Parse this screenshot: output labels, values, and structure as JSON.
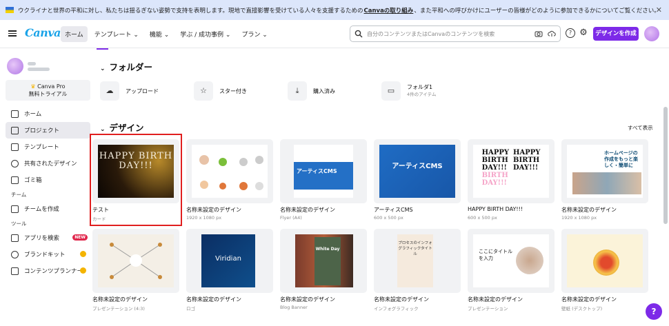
{
  "banner": {
    "text_before": "ウクライナと世界の平和に対し、私たちは揺るぎない姿勢で支持を表明します。現地で直接影響を受けている人々を支援するための",
    "link": "Canvaの取り組み",
    "text_after": "、また平和への呼びかけにユーザーの皆様がどのように参加できるかについてご覧ください。",
    "close": "✕"
  },
  "header": {
    "logo": "Canva",
    "nav": [
      "ホーム",
      "テンプレート ⌄",
      "機能 ⌄",
      "学ぶ / 成功事例 ⌄",
      "プラン ⌄"
    ],
    "search_placeholder": "自分のコンテンツまたはCanvaのコンテンツを検索",
    "help_icon": "?",
    "settings_icon": "⚙",
    "create_button": "デザインを作成"
  },
  "sidebar": {
    "pro_line1": "Canva Pro",
    "pro_line2": "無料トライアル",
    "items": [
      {
        "label": "ホーム",
        "active": false
      },
      {
        "label": "プロジェクト",
        "active": true
      },
      {
        "label": "テンプレート",
        "active": false
      },
      {
        "label": "共有されたデザイン",
        "active": false
      },
      {
        "label": "ゴミ箱",
        "active": false
      }
    ],
    "team_section": "チーム",
    "team_items": [
      {
        "label": "チームを作成"
      }
    ],
    "tools_section": "ツール",
    "tools_items": [
      {
        "label": "アプリを検索",
        "badge": "NEW"
      },
      {
        "label": "ブランドキット"
      },
      {
        "label": "コンテンツプランナー"
      }
    ]
  },
  "main": {
    "folders_title": "フォルダー",
    "folders": [
      {
        "label": "アップロード",
        "icon": "☁",
        "sub": ""
      },
      {
        "label": "スター付き",
        "icon": "☆",
        "sub": ""
      },
      {
        "label": "購入済み",
        "icon": "⤓",
        "sub": ""
      },
      {
        "label": "フォルダ1",
        "icon": "▭",
        "sub": "4件のアイテム"
      }
    ],
    "designs_title": "デザイン",
    "see_all": "すべて表示",
    "designs": [
      {
        "title": "テスト",
        "sub": "カード",
        "thumb_text": "HAPPY BIRTH DAY!!!"
      },
      {
        "title": "名称未設定のデザイン",
        "sub": "1920 x 1080 px"
      },
      {
        "title": "名称未設定のデザイン",
        "sub": "Flyer (A4)",
        "thumb_text": "アーティスCMS"
      },
      {
        "title": "アーティスCMS",
        "sub": "600 x 500 px",
        "thumb_text": "アーティスCMS"
      },
      {
        "title": "HAPPY BIRTH DAY!!!",
        "sub": "600 x 500 px"
      },
      {
        "title": "名称未設定のデザイン",
        "sub": "1920 x 1080 px",
        "thumb_text": "ホームページの作成をもっと楽しく・簡単に"
      },
      {
        "title": "名称未設定のデザイン",
        "sub": "プレゼンテーション (4:3)"
      },
      {
        "title": "名称未設定のデザイン",
        "sub": "ロゴ",
        "thumb_text": "Viridian"
      },
      {
        "title": "名称未設定のデザイン",
        "sub": "Blog Banner",
        "thumb_text": "White Day"
      },
      {
        "title": "名称未設定のデザイン",
        "sub": "インフォグラフィック",
        "thumb_text": "プロセスのインフォグラフィックタイトル"
      },
      {
        "title": "名称未設定のデザイン",
        "sub": "プレゼンテーション",
        "thumb_text": "ここにタイトルを入力"
      },
      {
        "title": "名称未設定のデザイン",
        "sub": "壁紙 (デスクトップ)"
      }
    ]
  },
  "help_fab": "?"
}
